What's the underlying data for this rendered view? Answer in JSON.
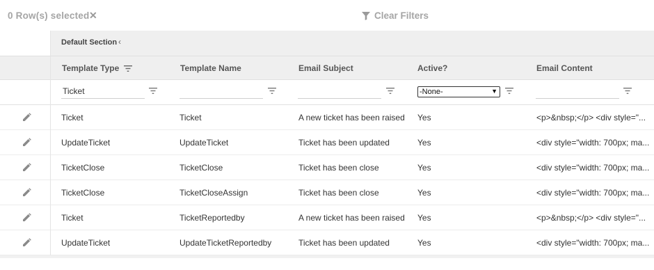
{
  "toolbar": {
    "selection_text": "0 Row(s) selected",
    "clear_selection_glyph": "✕",
    "clear_filters_label": "Clear Filters",
    "filter_icon": "funnel-icon"
  },
  "section": {
    "label": "Default Section",
    "collapse_glyph": "‹"
  },
  "columns": [
    {
      "label": "Template Type",
      "has_filter_icon": true
    },
    {
      "label": "Template Name"
    },
    {
      "label": "Email Subject"
    },
    {
      "label": "Active?"
    },
    {
      "label": "Email Content"
    }
  ],
  "filters": {
    "template_type": "Ticket",
    "template_name": "",
    "email_subject": "",
    "active": "-None-",
    "email_content": ""
  },
  "rows": [
    {
      "type": "Ticket",
      "name": "Ticket",
      "subject": "A new ticket has been raised",
      "active": "Yes",
      "content": "<p>&nbsp;</p> <div style=\"..."
    },
    {
      "type": "UpdateTicket",
      "name": "UpdateTicket",
      "subject": "Ticket has been updated",
      "active": "Yes",
      "content": "<div style=\"width: 700px; ma..."
    },
    {
      "type": "TicketClose",
      "name": "TicketClose",
      "subject": "Ticket has been close",
      "active": "Yes",
      "content": "<div style=\"width: 700px; ma..."
    },
    {
      "type": "TicketClose",
      "name": "TicketCloseAssign",
      "subject": "Ticket has been close",
      "active": "Yes",
      "content": "<div style=\"width: 700px; ma..."
    },
    {
      "type": "Ticket",
      "name": "TicketReportedby",
      "subject": "A new ticket has been raised",
      "active": "Yes",
      "content": "<p>&nbsp;</p> <div style=\"..."
    },
    {
      "type": "UpdateTicket",
      "name": "UpdateTicketReportedby",
      "subject": "Ticket has been updated",
      "active": "Yes",
      "content": "<div style=\"width: 700px; ma..."
    }
  ],
  "colors": {
    "header_bg": "#efefef",
    "muted_text": "#a5a5a5",
    "icon_gray": "#888888"
  }
}
